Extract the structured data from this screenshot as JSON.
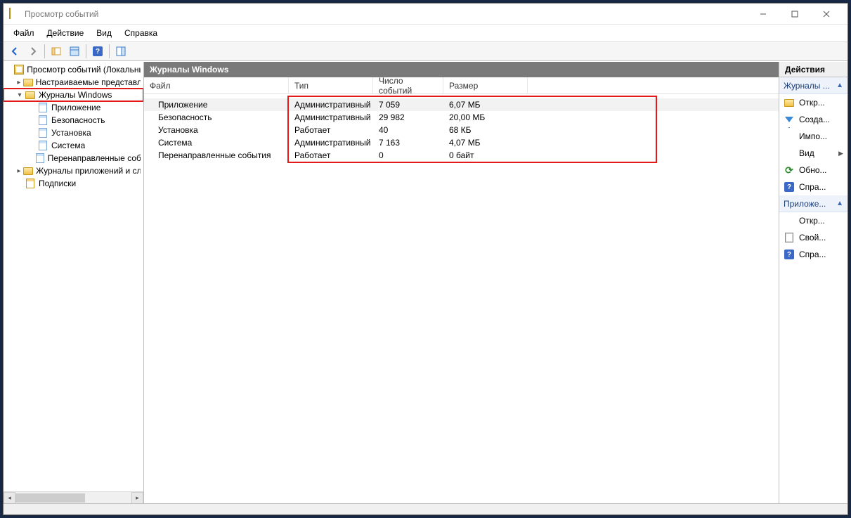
{
  "window": {
    "title": "Просмотр событий"
  },
  "menu": {
    "file": "Файл",
    "action": "Действие",
    "view": "Вид",
    "help": "Справка"
  },
  "tree": {
    "root": "Просмотр событий (Локальный)",
    "custom_views": "Настраиваемые представления",
    "win_logs": "Журналы Windows",
    "application": "Приложение",
    "security": "Безопасность",
    "setup": "Установка",
    "system": "Система",
    "forwarded": "Перенаправленные события",
    "app_services": "Журналы приложений и служб",
    "subscriptions": "Подписки"
  },
  "center": {
    "title": "Журналы Windows",
    "columns": {
      "name": "Файл",
      "type": "Тип",
      "count": "Число событий",
      "size": "Размер"
    },
    "rows": [
      {
        "name": "Приложение",
        "type": "Административный",
        "count": "7 059",
        "size": "6,07 МБ",
        "selected": true
      },
      {
        "name": "Безопасность",
        "type": "Административный",
        "count": "29 982",
        "size": "20,00 МБ",
        "selected": false
      },
      {
        "name": "Установка",
        "type": "Работает",
        "count": "40",
        "size": "68 КБ",
        "selected": false
      },
      {
        "name": "Система",
        "type": "Административный",
        "count": "7 163",
        "size": "4,07 МБ",
        "selected": false
      },
      {
        "name": "Перенаправленные события",
        "type": "Работает",
        "count": "0",
        "size": "0 байт",
        "selected": false
      }
    ]
  },
  "actions": {
    "header": "Действия",
    "group1": {
      "title": "Журналы ...",
      "open": "Откр...",
      "create": "Созда...",
      "import": "Импо...",
      "view": "Вид",
      "refresh": "Обно...",
      "help": "Спра..."
    },
    "group2": {
      "title": "Приложе...",
      "open": "Откр...",
      "props": "Свой...",
      "help": "Спра..."
    }
  }
}
